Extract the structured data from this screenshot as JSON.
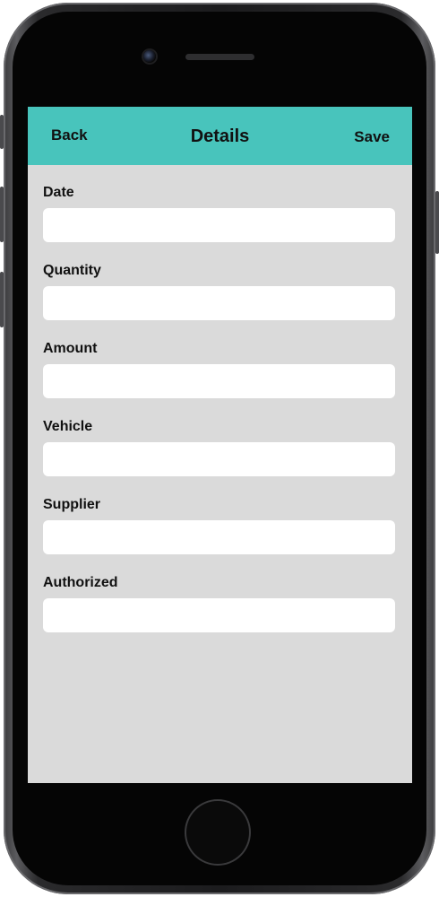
{
  "nav": {
    "back_label": "Back",
    "title": "Details",
    "save_label": "Save"
  },
  "form": {
    "fields": [
      {
        "label": "Date",
        "value": ""
      },
      {
        "label": "Quantity",
        "value": ""
      },
      {
        "label": "Amount",
        "value": ""
      },
      {
        "label": "Vehicle",
        "value": ""
      },
      {
        "label": "Supplier",
        "value": ""
      },
      {
        "label": "Authorized",
        "value": ""
      }
    ]
  },
  "colors": {
    "header": "#48c4bc",
    "screen_background": "#dadada",
    "input_background": "#ffffff",
    "device_body": "#1c1c1e"
  },
  "icons": {
    "front_camera": "camera-icon",
    "earpiece": "speaker-icon",
    "home": "home-button-icon"
  }
}
